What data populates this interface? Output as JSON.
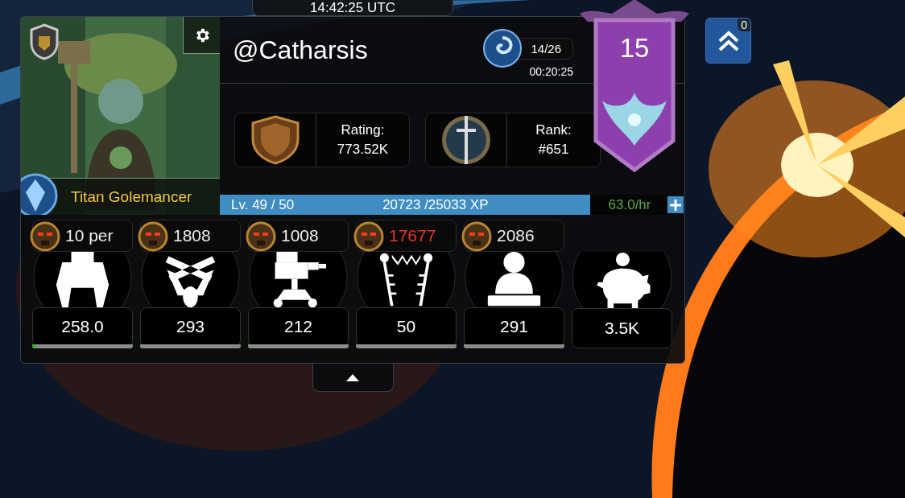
{
  "clock": "14:42:25 UTC",
  "profile": {
    "username": "@Catharsis",
    "title": "Titan Golemancer"
  },
  "energy": {
    "count": "14/26",
    "timer": "00:20:25"
  },
  "rating": {
    "label": "Rating:",
    "value": "773.52K"
  },
  "rank": {
    "label": "Rank:",
    "value": "#651"
  },
  "banner": {
    "number": "15"
  },
  "xp": {
    "level_text": "Lv. 49 / 50",
    "progress": "20723 /25033 XP",
    "rate": "63.0/hr",
    "level": 0.828
  },
  "upgrades": [
    {
      "kind": "robot",
      "cost": "10 per",
      "affordable": true,
      "value": "258.0",
      "level": 0.03
    },
    {
      "kind": "cheer",
      "cost": "1808",
      "affordable": true,
      "value": "293",
      "level": 0.01
    },
    {
      "kind": "turret",
      "cost": "1008",
      "affordable": true,
      "value": "212",
      "level": 0.01
    },
    {
      "kind": "electrode",
      "cost": "17677",
      "affordable": false,
      "value": "50"
    },
    {
      "kind": "meditate",
      "cost": "2086",
      "affordable": true,
      "value": "291"
    },
    {
      "kind": "savings",
      "value": "3.5K"
    }
  ],
  "notifications": {
    "count": "0"
  }
}
